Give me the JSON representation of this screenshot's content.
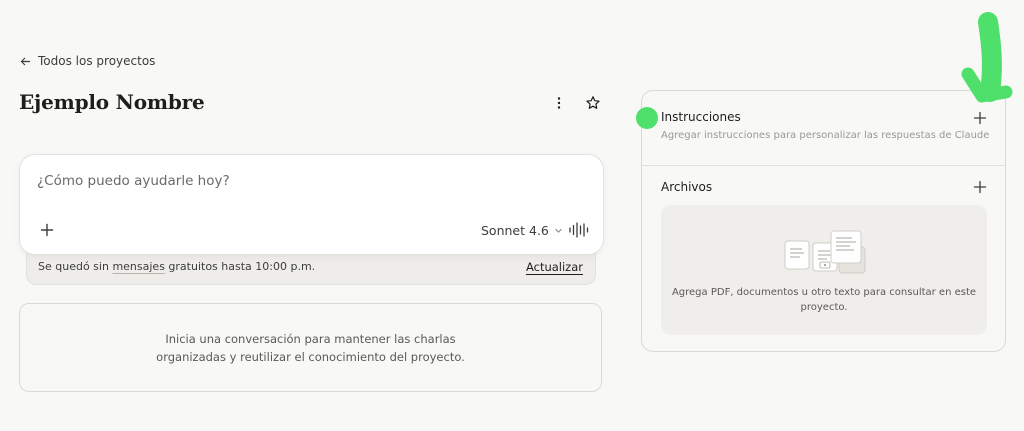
{
  "nav": {
    "back_label": "Todos los proyectos"
  },
  "project": {
    "title": "Ejemplo Nombre"
  },
  "composer": {
    "placeholder": "¿Cómo puedo ayudarle hoy?",
    "model": "Sonnet 4.6"
  },
  "limit_notice": {
    "text_before": "Se quedó sin ",
    "text_link": "mensajes",
    "text_after": " gratuitos hasta 10:00 p.m.",
    "upgrade_label": "Actualizar"
  },
  "empty_state": {
    "message": "Inicia una conversación para mantener las charlas organizadas y reutilizar el conocimiento del proyecto."
  },
  "side_panel": {
    "instructions": {
      "title": "Instrucciones",
      "description": "Agregar instrucciones para personalizar las respuestas de Claude"
    },
    "files": {
      "title": "Archivos",
      "dropzone_text": "Agrega PDF, documentos u otro texto para consultar en este proyecto."
    }
  },
  "annotation": {
    "color": "#4ee06a"
  },
  "icons": {
    "back": "arrow-left-icon",
    "more": "more-vertical-icon",
    "star": "star-icon",
    "add": "plus-icon",
    "dropdown": "chevron-down-icon",
    "voice": "voice-waveform-icon"
  }
}
